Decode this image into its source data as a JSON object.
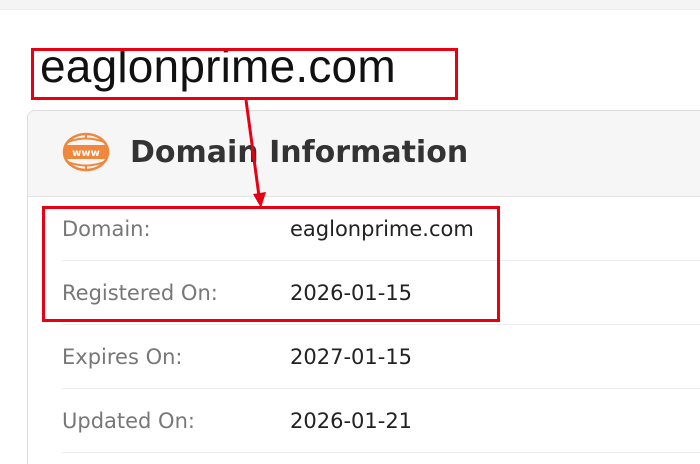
{
  "heading": {
    "domain": "eaglonprime.com"
  },
  "card": {
    "icon": "www-globe-icon",
    "icon_text": "www",
    "title": "Domain Information",
    "rows": [
      {
        "label": "Domain:",
        "value": "eaglonprime.com"
      },
      {
        "label": "Registered On:",
        "value": "2026-01-15"
      },
      {
        "label": "Expires On:",
        "value": "2027-01-15"
      },
      {
        "label": "Updated On:",
        "value": "2026-01-21"
      }
    ]
  },
  "colors": {
    "highlight": "#e60012",
    "icon_accent": "#f0873c",
    "header_bg": "#f6f6f6"
  }
}
